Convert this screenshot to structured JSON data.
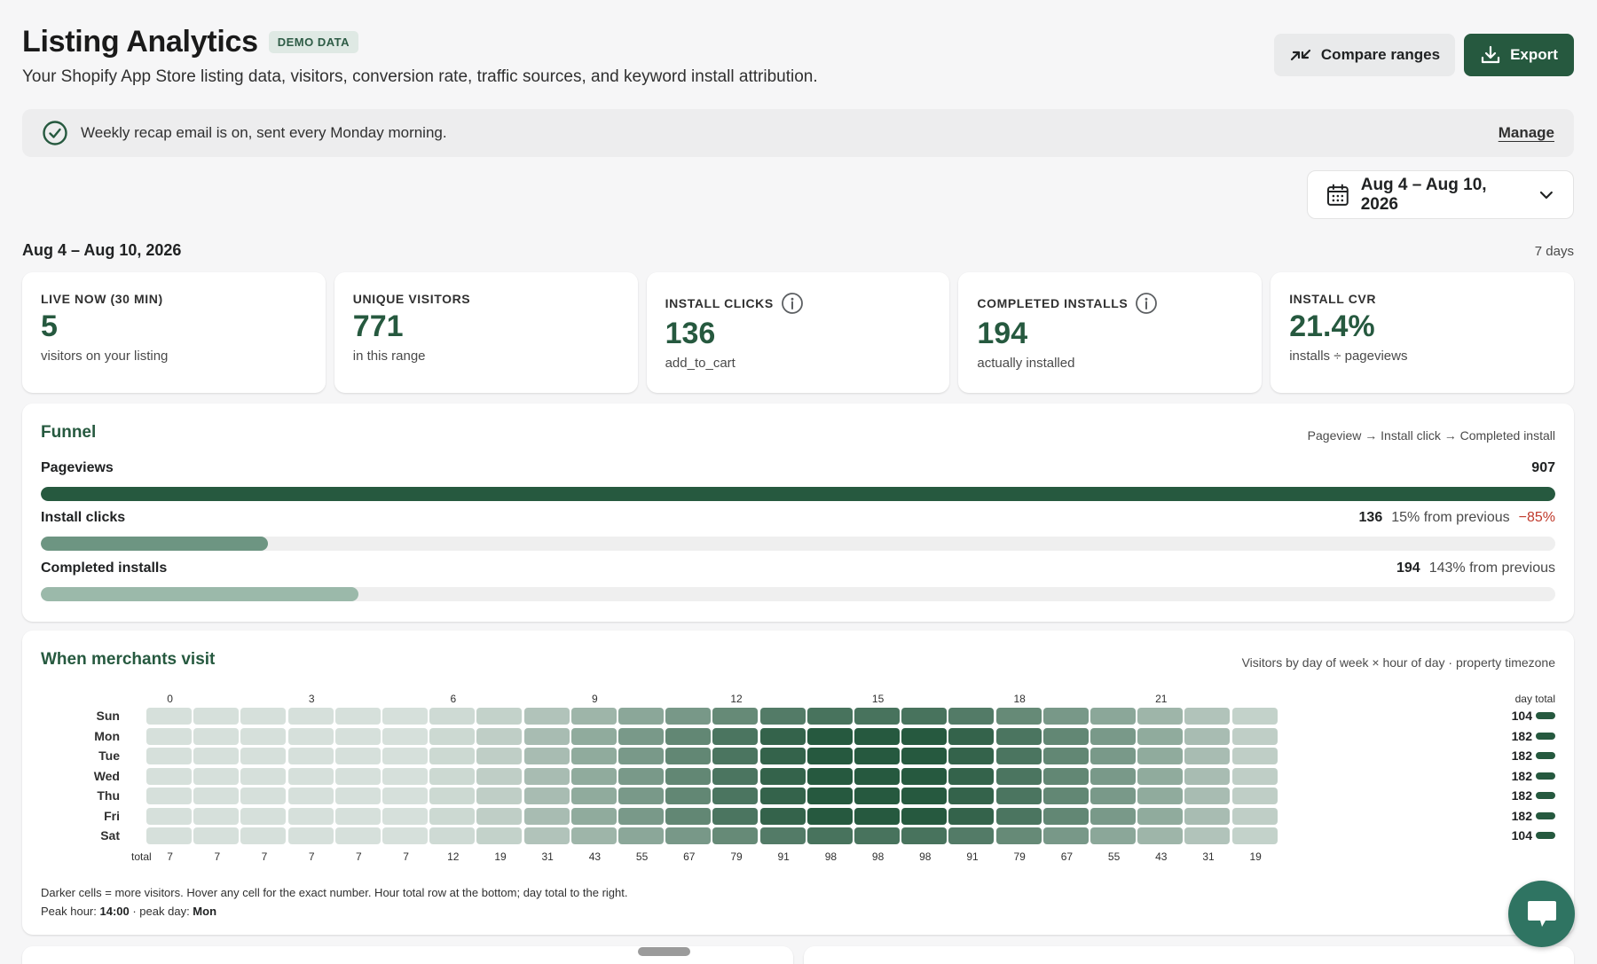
{
  "header": {
    "title": "Listing Analytics",
    "badge": "DEMO DATA",
    "subtitle": "Your Shopify App Store listing data, visitors, conversion rate, traffic sources, and keyword install attribution.",
    "compare_label": "Compare ranges",
    "export_label": "Export"
  },
  "recap": {
    "text": "Weekly recap email is on, sent every Monday morning.",
    "manage_label": "Manage"
  },
  "date_picker": {
    "label": "Aug 4 – Aug 10, 2026"
  },
  "range": {
    "label": "Aug 4 – Aug 10, 2026",
    "days": "7 days"
  },
  "kpis": [
    {
      "label": "LIVE NOW (30 MIN)",
      "value": "5",
      "sub": "visitors on your listing",
      "info": false
    },
    {
      "label": "UNIQUE VISITORS",
      "value": "771",
      "sub": "in this range",
      "info": false
    },
    {
      "label": "INSTALL CLICKS",
      "value": "136",
      "sub": "add_to_cart",
      "info": true
    },
    {
      "label": "COMPLETED INSTALLS",
      "value": "194",
      "sub": "actually installed",
      "info": true
    },
    {
      "label": "INSTALL CVR",
      "value": "21.4%",
      "sub": "installs ÷ pageviews",
      "info": false
    }
  ],
  "funnel": {
    "title": "Funnel",
    "hint": "Pageview → Install click → Completed install",
    "steps": [
      {
        "name": "Pageviews",
        "value": "907",
        "from_prev": "",
        "delta": "",
        "fraction": 1.0,
        "color": "#26593f"
      },
      {
        "name": "Install clicks",
        "value": "136",
        "from_prev": "15% from previous",
        "delta": "−85%",
        "fraction": 0.15,
        "color": "#6d9582"
      },
      {
        "name": "Completed installs",
        "value": "194",
        "from_prev": "143% from previous",
        "delta": "",
        "fraction": 0.21,
        "color": "#9bb9aa"
      }
    ]
  },
  "heatmap": {
    "title": "When merchants visit",
    "hint": "Visitors by day of week × hour of day · property timezone",
    "day_total_header": "day total",
    "hour_ticks": [
      "0",
      "3",
      "6",
      "9",
      "12",
      "15",
      "18",
      "21"
    ],
    "days": [
      "Sun",
      "Mon",
      "Tue",
      "Wed",
      "Thu",
      "Fri",
      "Sat"
    ],
    "day_totals": [
      "104",
      "182",
      "182",
      "182",
      "182",
      "182",
      "104"
    ],
    "total_label": "total",
    "hour_totals": [
      "7",
      "7",
      "7",
      "7",
      "7",
      "7",
      "12",
      "19",
      "31",
      "43",
      "55",
      "67",
      "79",
      "91",
      "98",
      "98",
      "98",
      "91",
      "79",
      "67",
      "55",
      "43",
      "31",
      "19"
    ],
    "foot_line1": "Darker cells = more visitors. Hover any cell for the exact number. Hour total row at the bottom; day total to the right.",
    "peak_hour_label": "Peak hour: ",
    "peak_hour": "14:00",
    "peak_day_label": " · peak day: ",
    "peak_day": "Mon",
    "color_low": "#d6e0db",
    "color_high": "#26593f"
  }
}
